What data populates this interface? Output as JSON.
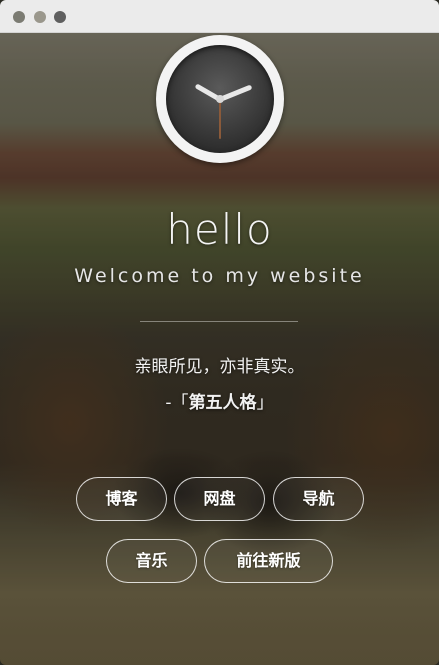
{
  "window": {
    "controls": [
      "close-dot",
      "minimize-dot",
      "maximize-dot"
    ]
  },
  "clock": {
    "icon": "clock-icon"
  },
  "hero": {
    "title": "hello",
    "subtitle": "Welcome to my website"
  },
  "quote": {
    "text": "亲眼所见，亦非真实。",
    "source_prefix": "-「",
    "source_title": "第五人格",
    "source_suffix": "」"
  },
  "links": {
    "blog": "博客",
    "netdisk": "网盘",
    "nav": "导航",
    "music": "音乐",
    "new_version": "前往新版"
  }
}
